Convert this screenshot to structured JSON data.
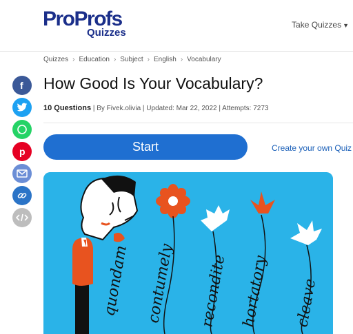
{
  "header": {
    "logo_main": "ProProfs",
    "logo_sub": "Quizzes",
    "take_quizzes": "Take Quizzes"
  },
  "breadcrumb": [
    "Quizzes",
    "Education",
    "Subject",
    "English",
    "Vocabulary"
  ],
  "social": [
    {
      "name": "facebook",
      "glyph": "f",
      "color": "#3b5998"
    },
    {
      "name": "twitter",
      "glyph": "t",
      "color": "#1da1f2"
    },
    {
      "name": "whatsapp",
      "glyph": "w",
      "color": "#25d366"
    },
    {
      "name": "pinterest",
      "glyph": "p",
      "color": "#e60023"
    },
    {
      "name": "email",
      "glyph": "✉",
      "color": "#6b8ed6"
    },
    {
      "name": "link",
      "glyph": "🔗",
      "color": "#2b74c7"
    },
    {
      "name": "embed",
      "glyph": "</>",
      "color": "#bdbdbd"
    }
  ],
  "quiz": {
    "title": "How Good Is Your Vocabulary?",
    "question_count": "10 Questions",
    "byline": " | By Fivek.olivia | Updated: Mar 22, 2022 | Attempts: 7273",
    "start_label": "Start",
    "create_label": "Create your own Quiz"
  },
  "illustration": {
    "words": [
      "quondam",
      "contumely",
      "recondite",
      "hortatory",
      "cleave"
    ],
    "background": "#2ab3e8",
    "flower_color": "#e8531f"
  }
}
